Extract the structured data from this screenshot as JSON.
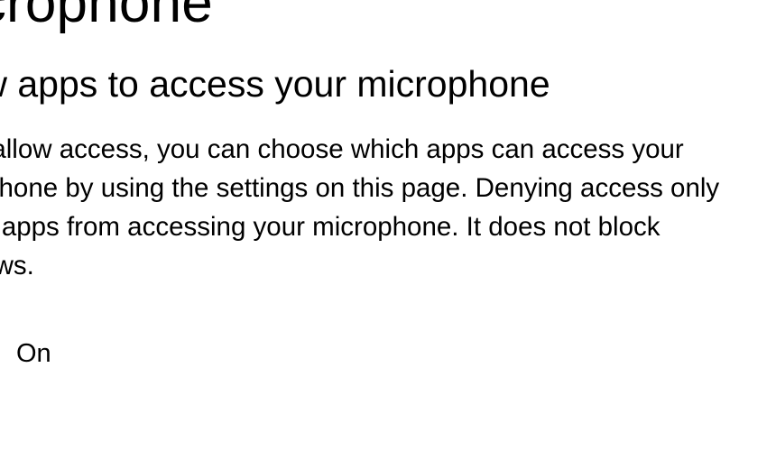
{
  "page": {
    "title": "Microphone"
  },
  "section": {
    "heading": "Allow apps to access your microphone",
    "body": "If you allow access, you can choose which apps can access your microphone by using the settings on this page. Denying access only blocks apps from accessing your microphone. It does not block Windows."
  },
  "toggle": {
    "state_label": "On",
    "value": true
  }
}
